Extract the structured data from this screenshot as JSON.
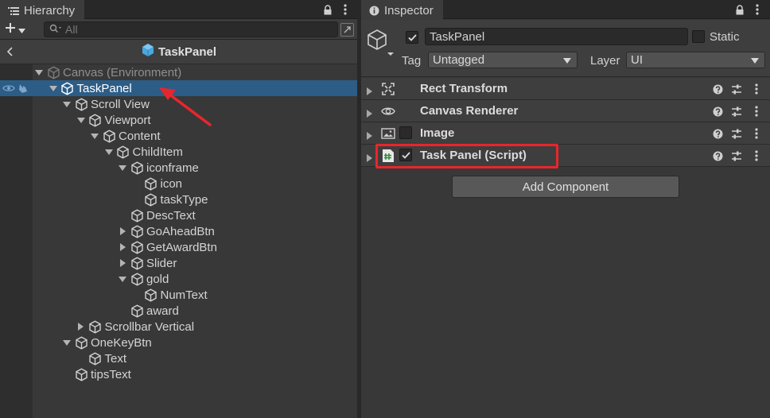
{
  "hierarchy": {
    "tab_label": "Hierarchy",
    "search_placeholder": "All",
    "prefab_title": "TaskPanel",
    "rows": [
      {
        "label": "Canvas (Environment)",
        "depth": 0,
        "arrow": "down",
        "env": true
      },
      {
        "label": "TaskPanel",
        "depth": 1,
        "arrow": "down",
        "selected": true
      },
      {
        "label": "Scroll View",
        "depth": 2,
        "arrow": "down"
      },
      {
        "label": "Viewport",
        "depth": 3,
        "arrow": "down"
      },
      {
        "label": "Content",
        "depth": 4,
        "arrow": "down"
      },
      {
        "label": "ChildItem",
        "depth": 5,
        "arrow": "down"
      },
      {
        "label": "iconframe",
        "depth": 6,
        "arrow": "down"
      },
      {
        "label": "icon",
        "depth": 7,
        "arrow": "none"
      },
      {
        "label": "taskType",
        "depth": 7,
        "arrow": "none"
      },
      {
        "label": "DescText",
        "depth": 6,
        "arrow": "none"
      },
      {
        "label": "GoAheadBtn",
        "depth": 6,
        "arrow": "right"
      },
      {
        "label": "GetAwardBtn",
        "depth": 6,
        "arrow": "right"
      },
      {
        "label": "Slider",
        "depth": 6,
        "arrow": "right"
      },
      {
        "label": "gold",
        "depth": 6,
        "arrow": "down"
      },
      {
        "label": "NumText",
        "depth": 7,
        "arrow": "none"
      },
      {
        "label": "award",
        "depth": 6,
        "arrow": "none"
      },
      {
        "label": "Scrollbar Vertical",
        "depth": 3,
        "arrow": "right"
      },
      {
        "label": "OneKeyBtn",
        "depth": 2,
        "arrow": "down"
      },
      {
        "label": "Text",
        "depth": 3,
        "arrow": "none"
      },
      {
        "label": "tipsText",
        "depth": 2,
        "arrow": "none"
      }
    ]
  },
  "inspector": {
    "tab_label": "Inspector",
    "object_name": "TaskPanel",
    "static_label": "Static",
    "tag_label": "Tag",
    "tag_value": "Untagged",
    "layer_label": "Layer",
    "layer_value": "UI",
    "components": [
      {
        "name": "Rect Transform",
        "icon": "rect-transform-icon",
        "has_checkbox": false
      },
      {
        "name": "Canvas Renderer",
        "icon": "eye-icon",
        "has_checkbox": false
      },
      {
        "name": "Image",
        "icon": "image-icon",
        "has_checkbox": true,
        "checked": false
      },
      {
        "name": "Task Panel (Script)",
        "icon": "script-icon",
        "has_checkbox": true,
        "checked": true
      }
    ],
    "add_component_label": "Add Component"
  },
  "colors": {
    "selection": "#2c5d87",
    "annotation": "#e8262c",
    "script_icon": "#4caf50"
  }
}
